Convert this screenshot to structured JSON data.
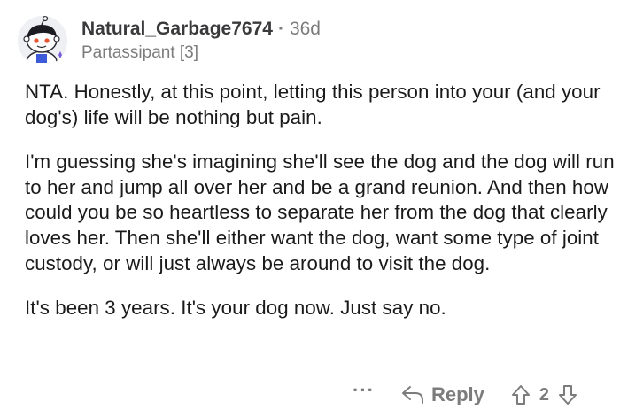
{
  "comment": {
    "username": "Natural_Garbage7674",
    "separator": "·",
    "age": "36d",
    "flair": "Partassipant [3]",
    "paragraphs": [
      "NTA. Honestly, at this point, letting this person into your (and your dog's) life will be nothing but pain.",
      "I'm guessing she's imagining she'll see the dog and the dog will run to her and jump all over her and be a grand reunion. And then how could you be so heartless to separate her from the dog that clearly loves her. Then she'll either want the dog, want some type of joint custody, or will just always be around to visit the dog.",
      "It's been 3 years. It's your dog now. Just say no."
    ],
    "actions": {
      "more": "···",
      "reply_label": "Reply",
      "vote_count": "2"
    },
    "icons": {
      "avatar": "snoo-avatar",
      "reply": "reply-arrow-icon",
      "upvote": "upvote-arrow-icon",
      "downvote": "downvote-arrow-icon",
      "more": "more-options-icon"
    },
    "colors": {
      "text": "#1a1a1b",
      "meta": "#7c7c7c"
    }
  }
}
